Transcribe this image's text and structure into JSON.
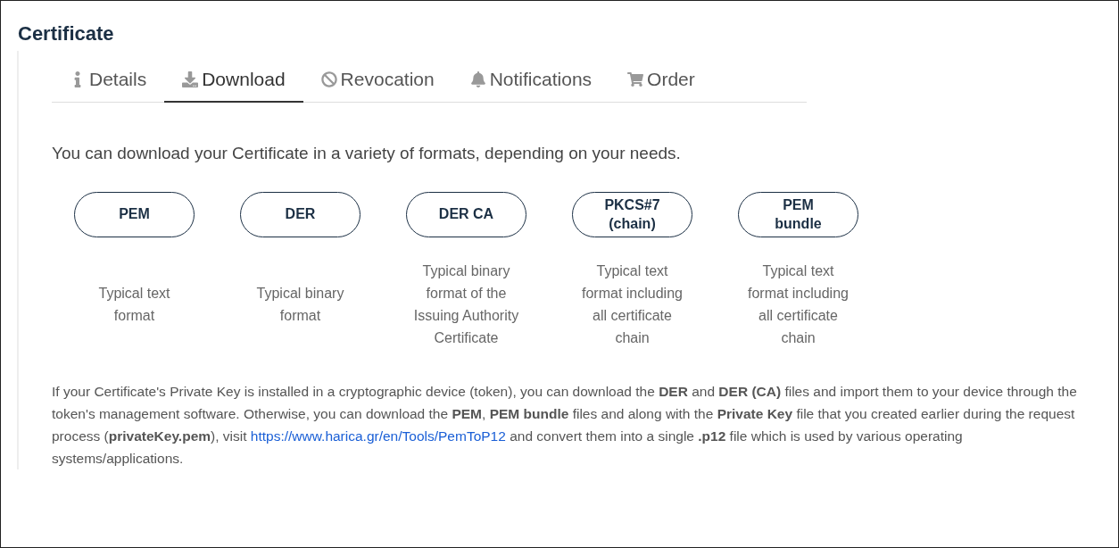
{
  "title": "Certificate",
  "tabs": [
    {
      "label": "Details",
      "kind": "info",
      "selected": false
    },
    {
      "label": "Download",
      "kind": "download",
      "selected": true
    },
    {
      "label": "Revocation",
      "kind": "ban",
      "selected": false
    },
    {
      "label": "Notifications",
      "kind": "bell",
      "selected": false
    },
    {
      "label": "Order",
      "kind": "cart",
      "selected": false
    }
  ],
  "intro": "You can download your Certificate in a variety of formats, depending on your needs.",
  "formats": [
    {
      "button": "PEM",
      "description": "Typical text format"
    },
    {
      "button": "DER",
      "description": "Typical binary format"
    },
    {
      "button": "DER CA",
      "description": "Typical binary format of the Issuing Authority Certificate"
    },
    {
      "button": "PKCS#7 (chain)",
      "description": "Typical text format including all certificate chain"
    },
    {
      "button": "PEM bundle",
      "description": "Typical text format including all certificate chain"
    }
  ],
  "note": {
    "before": "If your Certificate's Private Key is installed in a cryptographic device (token), you can download the **DER** and **DER (CA)** files and import them to your device through the token's management software. Otherwise, you can download the **PEM**, **PEM bundle** files and along with the **Private Key** file that you created earlier during the request process (**privateKey.pem**), visit",
    "link": "https://www.harica.gr/en/Tools/PemToP12",
    "after": "and convert them into a single **.p12** file which is used by various operating systems/applications."
  }
}
